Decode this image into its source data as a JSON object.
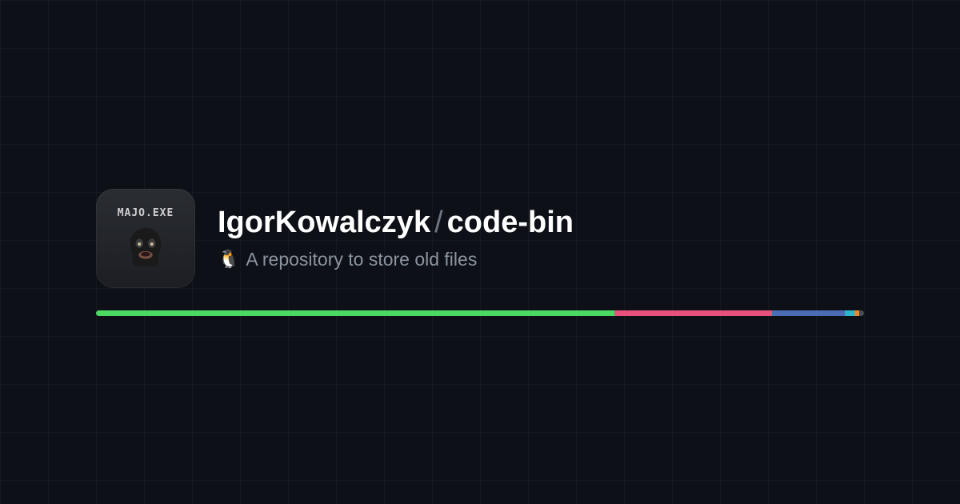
{
  "avatar": {
    "label": "MAJO.EXE"
  },
  "repo": {
    "owner": "IgorKowalczyk",
    "name": "code-bin"
  },
  "description": {
    "emoji": "🐧",
    "text": "A repository to store old files"
  },
  "languages": [
    {
      "name": "green",
      "color": "#4bd964",
      "percent": 67.5
    },
    {
      "name": "pink",
      "color": "#e7517b",
      "percent": 20.5
    },
    {
      "name": "blue",
      "color": "#4c6cb3",
      "percent": 9.5
    },
    {
      "name": "teal",
      "color": "#2fb5c9",
      "percent": 1.2
    },
    {
      "name": "orange",
      "color": "#e38a2f",
      "percent": 0.7
    },
    {
      "name": "gray",
      "color": "#444c56",
      "percent": 0.6
    }
  ]
}
